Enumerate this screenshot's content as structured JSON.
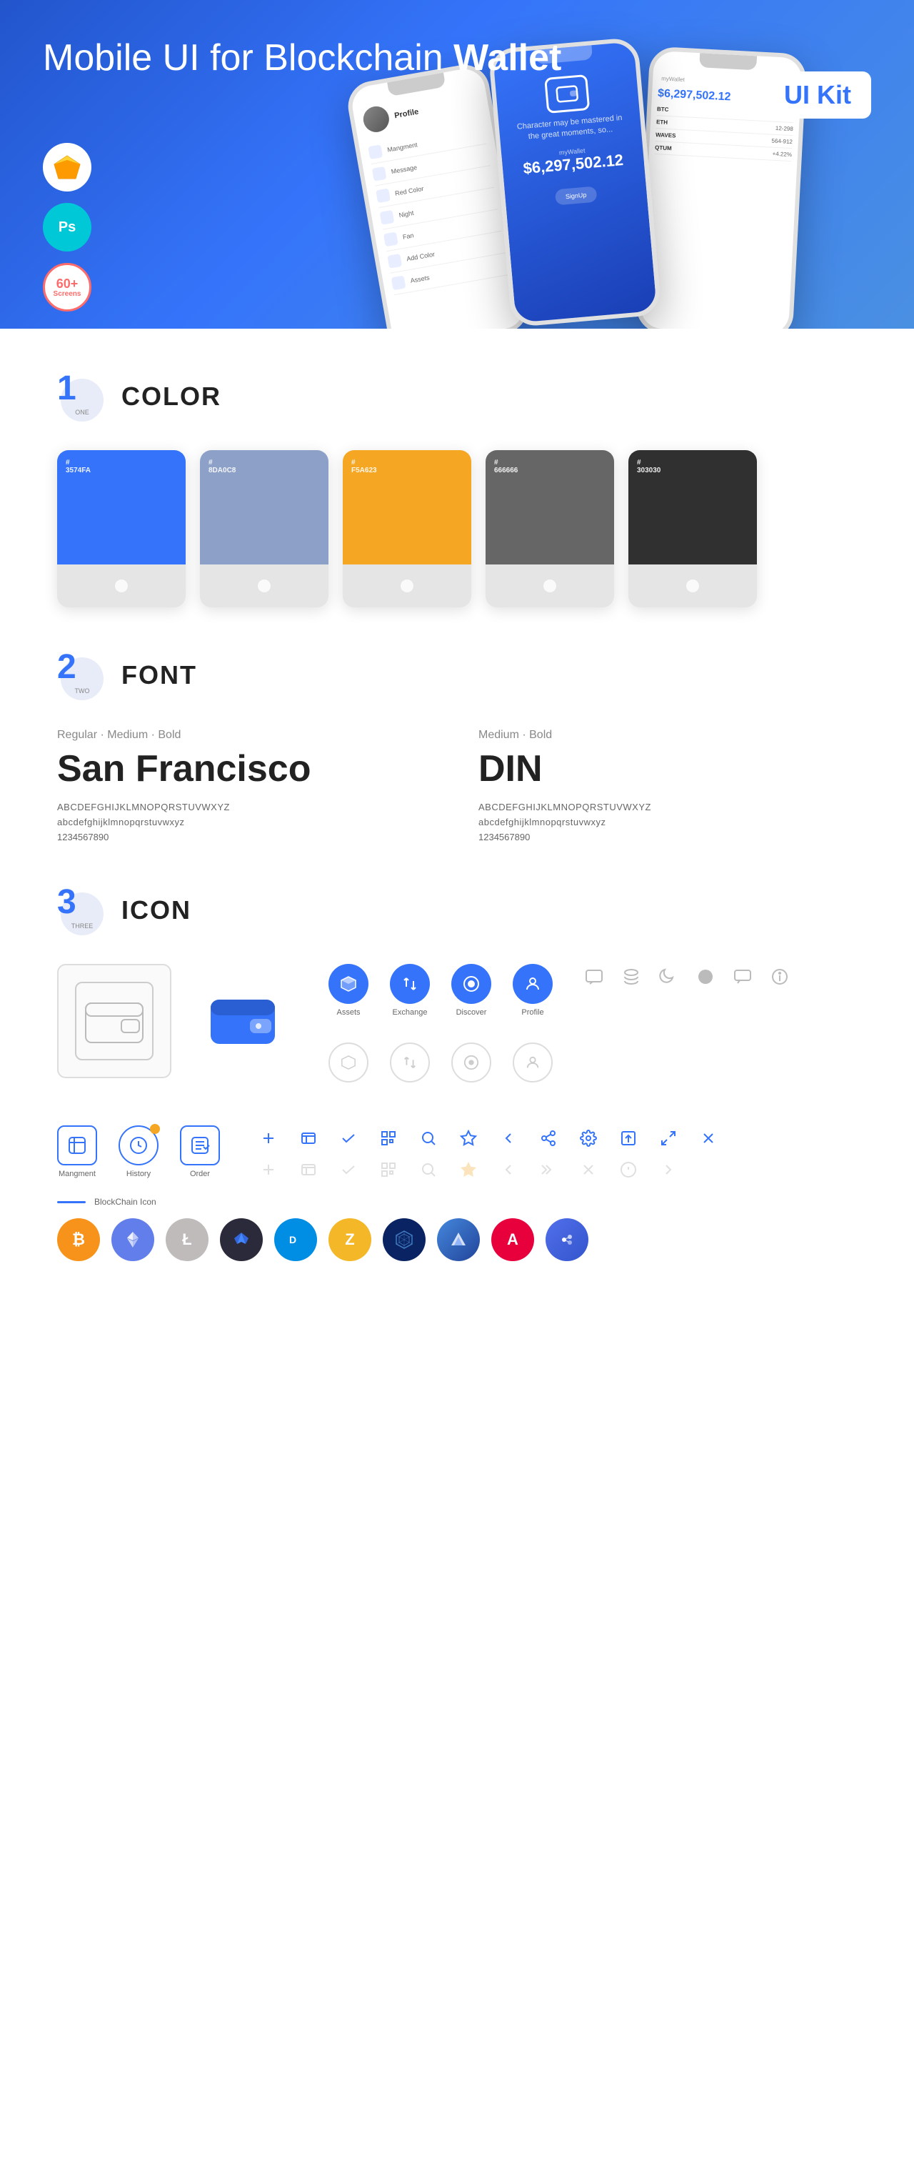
{
  "hero": {
    "title_normal": "Mobile UI for Blockchain ",
    "title_bold": "Wallet",
    "badge": "UI Kit",
    "badges": [
      {
        "type": "sketch",
        "label": "Sketch"
      },
      {
        "type": "ps",
        "label": "Ps"
      },
      {
        "type": "screens",
        "line1": "60+",
        "line2": "Screens"
      }
    ]
  },
  "sections": {
    "color": {
      "number": "1",
      "word": "ONE",
      "title": "COLOR",
      "swatches": [
        {
          "hex": "#3574FA",
          "label": "#\n3574FA"
        },
        {
          "hex": "#8DA0C8",
          "label": "#\n8DA0C8"
        },
        {
          "hex": "#F5A623",
          "label": "#\nF5A623"
        },
        {
          "hex": "#666666",
          "label": "#\n666666"
        },
        {
          "hex": "#303030",
          "label": "#\n303030"
        }
      ]
    },
    "font": {
      "number": "2",
      "word": "TWO",
      "title": "FONT",
      "fonts": [
        {
          "styles": "Regular · Medium · Bold",
          "name": "San Francisco",
          "uppercase": "ABCDEFGHIJKLMNOPQRSTUVWXYZ",
          "lowercase": "abcdefghijklmnopqrstuvwxyz",
          "numbers": "1234567890"
        },
        {
          "styles": "Medium · Bold",
          "name": "DIN",
          "uppercase": "ABCDEFGHIJKLMNOPQRSTUVWXYZ",
          "lowercase": "abcdefghijklmnopqrstuvwxyz",
          "numbers": "1234567890"
        }
      ]
    },
    "icon": {
      "number": "3",
      "word": "THREE",
      "title": "ICON",
      "nav_icons": [
        {
          "label": "Assets"
        },
        {
          "label": "Exchange"
        },
        {
          "label": "Discover"
        },
        {
          "label": "Profile"
        }
      ],
      "bottom_icons": [
        {
          "label": "Mangment"
        },
        {
          "label": "History"
        },
        {
          "label": "Order"
        }
      ],
      "blockchain_label": "BlockChain Icon",
      "crypto_icons": [
        {
          "symbol": "₿",
          "name": "Bitcoin",
          "class": "crypto-btc"
        },
        {
          "symbol": "Ξ",
          "name": "Ethereum",
          "class": "crypto-eth"
        },
        {
          "symbol": "Ł",
          "name": "Litecoin",
          "class": "crypto-ltc"
        },
        {
          "symbol": "◆",
          "name": "Wings",
          "class": "crypto-wings"
        },
        {
          "symbol": "D",
          "name": "Dash",
          "class": "crypto-dash"
        },
        {
          "symbol": "Z",
          "name": "ZCash",
          "class": "crypto-zcash"
        },
        {
          "symbol": "⬡",
          "name": "Web",
          "class": "crypto-web"
        },
        {
          "symbol": "▲",
          "name": "Lisk",
          "class": "crypto-lisk"
        },
        {
          "symbol": "A",
          "name": "Ark",
          "class": "crypto-ark"
        },
        {
          "symbol": "⬡",
          "name": "Band",
          "class": "crypto-band"
        }
      ]
    }
  }
}
